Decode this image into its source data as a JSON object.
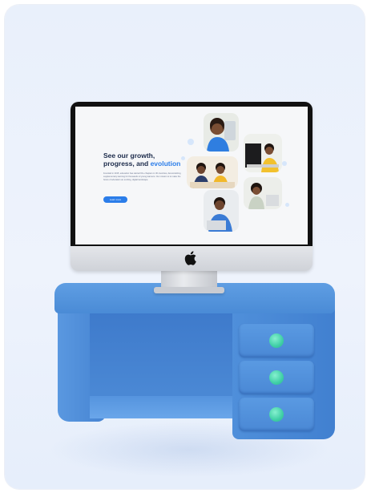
{
  "hero": {
    "title_line1": "See our growth,",
    "title_line2_prefix": "progress, and ",
    "title_accent": "evolution",
    "body": "Founded in 2015, eduvation has started 60+ chapters in 30 countries, democratizing supplementary learning for thousands of young learners. Our mission is to make the future of education an exciting, digital landscape.",
    "button_label": "Learn more"
  },
  "colors": {
    "accent": "#2b7de9",
    "desk_blue": "#4a8bd6",
    "knob_teal": "#3fcfa6",
    "background": "#eaf1fb"
  },
  "icons": {
    "monitor_logo": "apple-logo-icon"
  }
}
